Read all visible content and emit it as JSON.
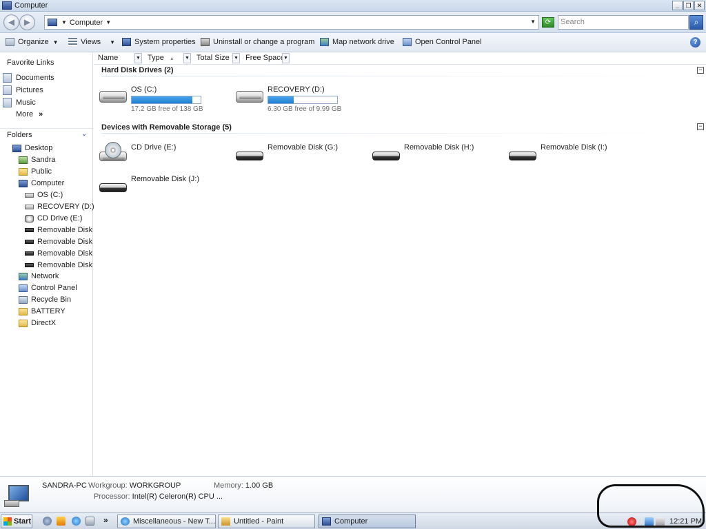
{
  "window": {
    "title": "Computer"
  },
  "address": {
    "crumb": "Computer",
    "search_placeholder": "Search"
  },
  "commands": {
    "organize": "Organize",
    "views": "Views",
    "system_properties": "System properties",
    "uninstall": "Uninstall or change a program",
    "map_drive": "Map network drive",
    "control_panel": "Open Control Panel"
  },
  "nav": {
    "favorites_heading": "Favorite Links",
    "favorites": [
      "Documents",
      "Pictures",
      "Music"
    ],
    "more": "More",
    "folders_heading": "Folders",
    "tree": [
      "Desktop",
      "Sandra",
      "Public",
      "Computer",
      "OS (C:)",
      "RECOVERY (D:)",
      "CD Drive (E:)",
      "Removable Disk",
      "Removable Disk",
      "Removable Disk",
      "Removable Disk",
      "Network",
      "Control Panel",
      "Recycle Bin",
      "BATTERY",
      "DirectX"
    ]
  },
  "columns": [
    "Name",
    "Type",
    "Total Size",
    "Free Space"
  ],
  "groups": {
    "hdd_heading": "Hard Disk Drives (2)",
    "removable_heading": "Devices with Removable Storage (5)"
  },
  "hard_drives": [
    {
      "name": "OS (C:)",
      "free_text": "17.2 GB free of 138 GB",
      "used_fraction": 0.875
    },
    {
      "name": "RECOVERY (D:)",
      "free_text": "6.30 GB free of 9.99 GB",
      "used_fraction": 0.37
    }
  ],
  "removable": [
    "CD Drive (E:)",
    "Removable Disk (G:)",
    "Removable Disk (H:)",
    "Removable Disk (I:)",
    "Removable Disk (J:)"
  ],
  "details": {
    "computer_name": "SANDRA-PC",
    "workgroup_label": "Workgroup:",
    "workgroup": "WORKGROUP",
    "memory_label": "Memory:",
    "memory": "1.00 GB",
    "processor_label": "Processor:",
    "processor": "Intel(R) Celeron(R) CPU ..."
  },
  "taskbar": {
    "start": "Start",
    "overflow": "»",
    "items": [
      "Miscellaneous - New T...",
      "Untitled - Paint",
      "Computer"
    ],
    "clock": "12:21 PM"
  },
  "colors": {
    "bar_fill": "#1f7fd1",
    "accent": "#2e5196"
  }
}
